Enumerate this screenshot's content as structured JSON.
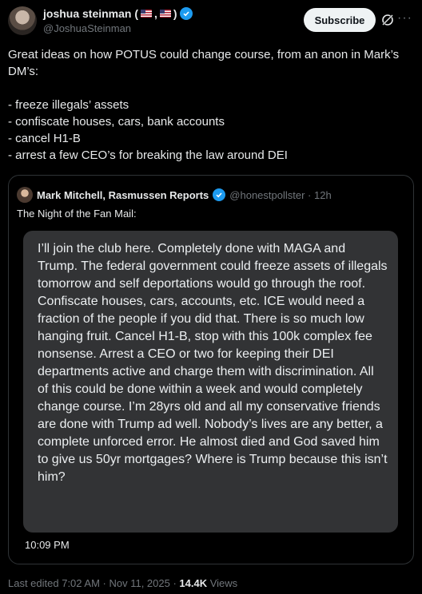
{
  "author": {
    "name": "joshua steinman (",
    "name_close": ")",
    "handle": "@JoshuaSteinman",
    "subscribe_label": "Subscribe"
  },
  "tweet": {
    "line1": "Great ideas on how POTUS could change course, from an anon in Mark’s DM’s:",
    "bullets": [
      "- freeze illegals’ assets",
      "- confiscate houses, cars, bank accounts",
      "- cancel H1-B",
      "- arrest a few CEO’s for breaking the law around DEI"
    ]
  },
  "quote": {
    "name": "Mark Mitchell, Rasmussen Reports",
    "handle_time": "@honestpollster · 12h",
    "caption": "The Night of the Fan Mail:",
    "message": "I’ll join the club here. Completely done with MAGA and Trump. The federal government could freeze assets of illegals tomorrow and self deportations would go through the roof. Confiscate houses, cars, accounts, etc. ICE would need a fraction of the people if you did that. There is so much low hanging fruit. Cancel H1-B, stop with this 100k complex fee nonsense. Arrest a CEO or two for keeping their DEI departments active and charge them with discrimination. All of this could be done within a week and would completely change course. I’m 28yrs old and all my conservative friends are done with Trump ad well. Nobody’s lives are any better, a complete unforced error. He almost died and God saved him to give us 50yr mortgages? Where is Trump because this isn’t him?",
    "message_time": "10:09 PM"
  },
  "footer": {
    "edited": "Last edited 7:02 AM · Nov 11, 2025 · ",
    "views_count": "14.4K",
    "views_label": " Views"
  },
  "colors": {
    "background": "#000000",
    "verified": "#1d9bf0",
    "muted": "#71767b"
  }
}
